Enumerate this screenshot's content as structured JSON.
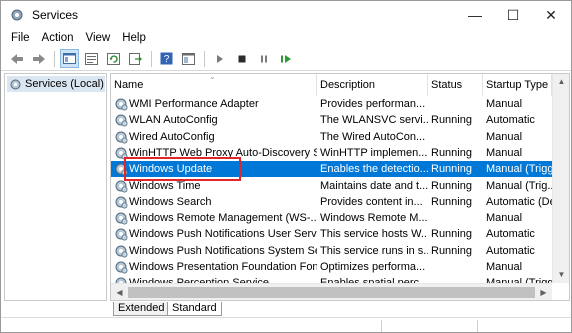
{
  "window": {
    "title": "Services",
    "minimize_glyph": "—",
    "maximize_glyph": "☐",
    "close_glyph": "✕"
  },
  "menu": [
    "File",
    "Action",
    "View",
    "Help"
  ],
  "toolbar": {
    "icons": [
      "back-arrow-icon",
      "forward-arrow-icon",
      "show-hide-tree-icon",
      "properties-icon",
      "refresh-icon",
      "export-list-icon",
      "help-icon",
      "console-icon",
      "start-service-icon",
      "stop-service-icon",
      "pause-service-icon",
      "restart-service-icon"
    ]
  },
  "left_pane": {
    "item_label": "Services (Local)"
  },
  "table": {
    "columns": [
      "Name",
      "Description",
      "Status",
      "Startup Type"
    ],
    "rows": [
      {
        "name": "WMI Performance Adapter",
        "description": "Provides performan...",
        "status": "",
        "startup": "Manual"
      },
      {
        "name": "WLAN AutoConfig",
        "description": "The WLANSVC servi...",
        "status": "Running",
        "startup": "Automatic"
      },
      {
        "name": "Wired AutoConfig",
        "description": "The Wired AutoCon...",
        "status": "",
        "startup": "Manual"
      },
      {
        "name": "WinHTTP Web Proxy Auto-Discovery S...",
        "description": "WinHTTP implemen...",
        "status": "Running",
        "startup": "Manual"
      },
      {
        "name": "Windows Update",
        "description": "Enables the detectio...",
        "status": "Running",
        "startup": "Manual (Trigger...",
        "selected": true
      },
      {
        "name": "Windows Time",
        "description": "Maintains date and t...",
        "status": "Running",
        "startup": "Manual (Trig..."
      },
      {
        "name": "Windows Search",
        "description": "Provides content in...",
        "status": "Running",
        "startup": "Automatic (Del..."
      },
      {
        "name": "Windows Remote Management (WS-...",
        "description": "Windows Remote M...",
        "status": "",
        "startup": "Manual"
      },
      {
        "name": "Windows Push Notifications User Servi...",
        "description": "This service hosts W...",
        "status": "Running",
        "startup": "Automatic"
      },
      {
        "name": "Windows Push Notifications System Se...",
        "description": "This service runs in s...",
        "status": "Running",
        "startup": "Automatic"
      },
      {
        "name": "Windows Presentation Foundation Fon...",
        "description": "Optimizes performa...",
        "status": "",
        "startup": "Manual"
      },
      {
        "name": "Windows Perception Service",
        "description": "Enables spatial perc...",
        "status": "",
        "startup": "Manual (Trigger..."
      }
    ]
  },
  "tabs": [
    "Extended",
    "Standard"
  ],
  "colors": {
    "selection": "#0078d7",
    "highlight_box": "#e0262b",
    "left_item_bg": "#dbe6f3"
  }
}
